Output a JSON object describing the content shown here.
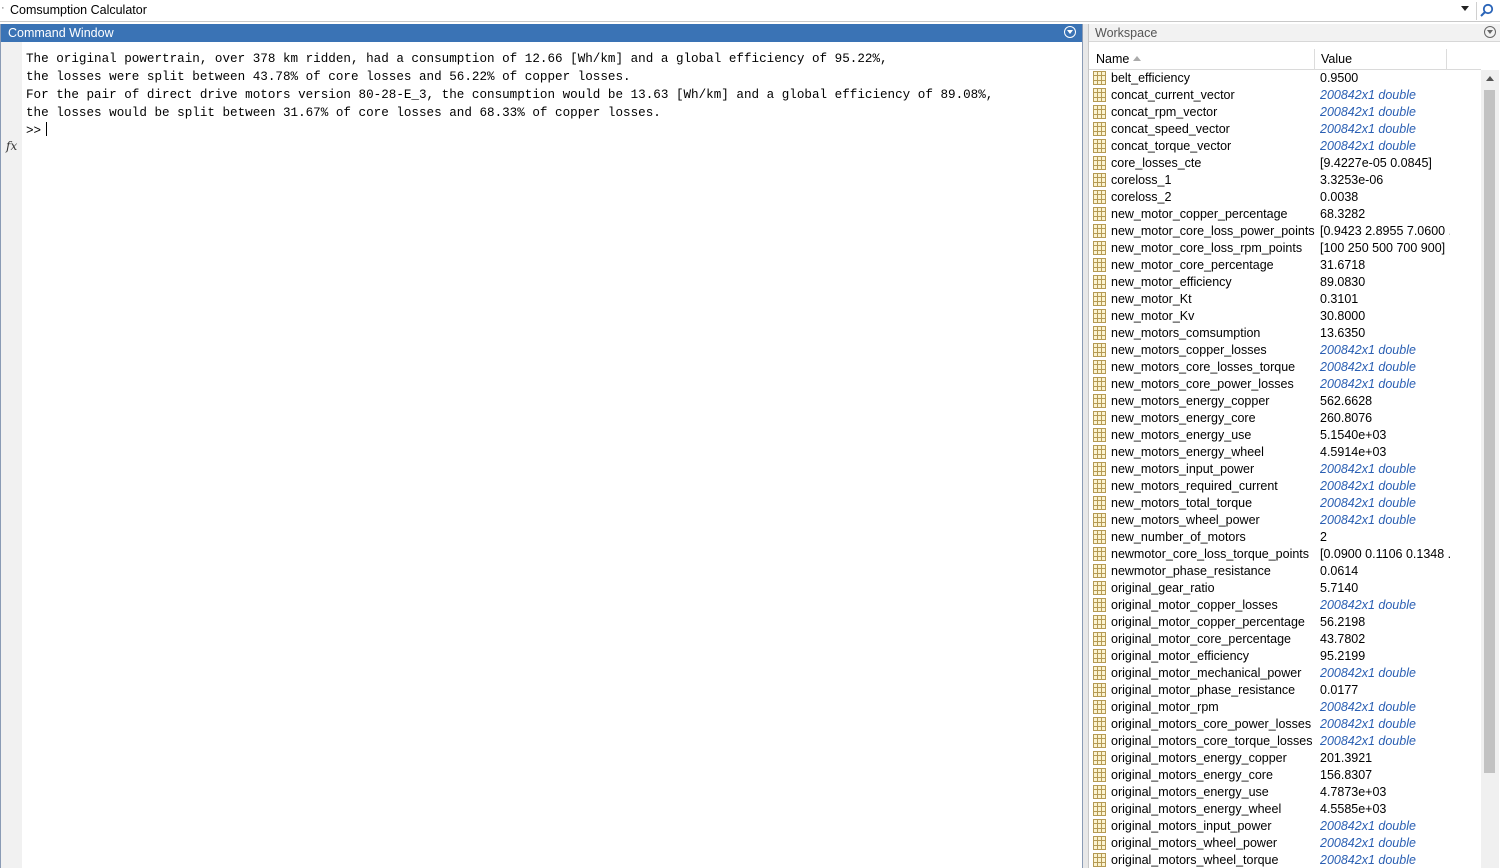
{
  "address_bar": {
    "path": "Comsumption Calculator"
  },
  "command_window": {
    "title": "Command Window",
    "lines": [
      "The original powertrain, over 378 km ridden, had a consumption of 12.66 [Wh/km] and a global efficiency of 95.22%,",
      "the losses were split between 43.78% of core losses and 56.22% of copper losses.",
      "For the pair of direct drive motors version 80-28-E_3, the consumption would be 13.63 [Wh/km] and a global efficiency of 89.08%,",
      "the losses would be split between 31.67% of core losses and 68.33% of copper losses."
    ],
    "fx_label": "fx",
    "prompt": ">>"
  },
  "workspace": {
    "title": "Workspace",
    "columns": {
      "name": "Name",
      "value": "Value"
    },
    "variables": [
      {
        "name": "belt_efficiency",
        "value": "0.9500",
        "ref": false
      },
      {
        "name": "concat_current_vector",
        "value": "200842x1 double",
        "ref": true
      },
      {
        "name": "concat_rpm_vector",
        "value": "200842x1 double",
        "ref": true
      },
      {
        "name": "concat_speed_vector",
        "value": "200842x1 double",
        "ref": true
      },
      {
        "name": "concat_torque_vector",
        "value": "200842x1 double",
        "ref": true
      },
      {
        "name": "core_losses_cte",
        "value": "[9.4227e-05 0.0845]",
        "ref": false
      },
      {
        "name": "coreloss_1",
        "value": "3.3253e-06",
        "ref": false
      },
      {
        "name": "coreloss_2",
        "value": "0.0038",
        "ref": false
      },
      {
        "name": "new_motor_copper_percentage",
        "value": "68.3282",
        "ref": false
      },
      {
        "name": "new_motor_core_loss_power_points",
        "value": "[0.9423 2.8955 7.0600 ...",
        "ref": false
      },
      {
        "name": "new_motor_core_loss_rpm_points",
        "value": "[100 250 500 700 900]",
        "ref": false
      },
      {
        "name": "new_motor_core_percentage",
        "value": "31.6718",
        "ref": false
      },
      {
        "name": "new_motor_efficiency",
        "value": "89.0830",
        "ref": false
      },
      {
        "name": "new_motor_Kt",
        "value": "0.3101",
        "ref": false
      },
      {
        "name": "new_motor_Kv",
        "value": "30.8000",
        "ref": false
      },
      {
        "name": "new_motors_comsumption",
        "value": "13.6350",
        "ref": false
      },
      {
        "name": "new_motors_copper_losses",
        "value": "200842x1 double",
        "ref": true
      },
      {
        "name": "new_motors_core_losses_torque",
        "value": "200842x1 double",
        "ref": true
      },
      {
        "name": "new_motors_core_power_losses",
        "value": "200842x1 double",
        "ref": true
      },
      {
        "name": "new_motors_energy_copper",
        "value": "562.6628",
        "ref": false
      },
      {
        "name": "new_motors_energy_core",
        "value": "260.8076",
        "ref": false
      },
      {
        "name": "new_motors_energy_use",
        "value": "5.1540e+03",
        "ref": false
      },
      {
        "name": "new_motors_energy_wheel",
        "value": "4.5914e+03",
        "ref": false
      },
      {
        "name": "new_motors_input_power",
        "value": "200842x1 double",
        "ref": true
      },
      {
        "name": "new_motors_required_current",
        "value": "200842x1 double",
        "ref": true
      },
      {
        "name": "new_motors_total_torque",
        "value": "200842x1 double",
        "ref": true
      },
      {
        "name": "new_motors_wheel_power",
        "value": "200842x1 double",
        "ref": true
      },
      {
        "name": "new_number_of_motors",
        "value": "2",
        "ref": false
      },
      {
        "name": "newmotor_core_loss_torque_points",
        "value": "[0.0900 0.1106 0.1348 ...",
        "ref": false
      },
      {
        "name": "newmotor_phase_resistance",
        "value": "0.0614",
        "ref": false
      },
      {
        "name": "original_gear_ratio",
        "value": "5.7140",
        "ref": false
      },
      {
        "name": "original_motor_copper_losses",
        "value": "200842x1 double",
        "ref": true
      },
      {
        "name": "original_motor_copper_percentage",
        "value": "56.2198",
        "ref": false
      },
      {
        "name": "original_motor_core_percentage",
        "value": "43.7802",
        "ref": false
      },
      {
        "name": "original_motor_efficiency",
        "value": "95.2199",
        "ref": false
      },
      {
        "name": "original_motor_mechanical_power",
        "value": "200842x1 double",
        "ref": true
      },
      {
        "name": "original_motor_phase_resistance",
        "value": "0.0177",
        "ref": false
      },
      {
        "name": "original_motor_rpm",
        "value": "200842x1 double",
        "ref": true
      },
      {
        "name": "original_motors_core_power_losses",
        "value": "200842x1 double",
        "ref": true
      },
      {
        "name": "original_motors_core_torque_losses",
        "value": "200842x1 double",
        "ref": true
      },
      {
        "name": "original_motors_energy_copper",
        "value": "201.3921",
        "ref": false
      },
      {
        "name": "original_motors_energy_core",
        "value": "156.8307",
        "ref": false
      },
      {
        "name": "original_motors_energy_use",
        "value": "4.7873e+03",
        "ref": false
      },
      {
        "name": "original_motors_energy_wheel",
        "value": "4.5585e+03",
        "ref": false
      },
      {
        "name": "original_motors_input_power",
        "value": "200842x1 double",
        "ref": true
      },
      {
        "name": "original_motors_wheel_power",
        "value": "200842x1 double",
        "ref": true
      },
      {
        "name": "original_motors_wheel_torque",
        "value": "200842x1 double",
        "ref": true
      }
    ]
  },
  "colors": {
    "active_titlebar": "#3a73b5",
    "reference_value": "#2a5fb3"
  }
}
